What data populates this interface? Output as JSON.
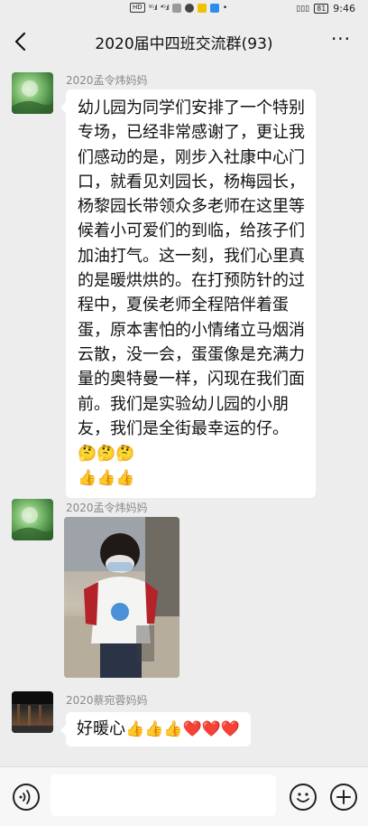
{
  "status_bar": {
    "hd": "HD",
    "signal1": "⁵ᴳ.ıl",
    "signal2": "⁴ᴳ.ıl",
    "vibrate": "▯▯▯",
    "battery": "81",
    "time": "9:46"
  },
  "header": {
    "title": "2020届中四班交流群(93)",
    "more": "···"
  },
  "messages": [
    {
      "sender": "2020孟令炜妈妈",
      "text": "幼儿园为同学们安排了一个特别专场，已经非常感谢了，更让我们感动的是，刚步入社康中心门口，就看见刘园长，杨梅园长，杨黎园长带领众多老师在这里等候着小可爱们的到临，给孩子们加油打气。这一刻，我们心里真的是暖烘烘的。在打预防针的过程中，夏侯老师全程陪伴着蛋蛋，原本害怕的小情绪立马烟消云散，没一会，蛋蛋像是充满力量的奥特曼一样，闪现在我们面前。我们是实验幼儿园的小朋友，我们是全街最幸运的仔。",
      "emoji_tail": "🤔🤔🤔",
      "emoji_line": "👍👍👍"
    },
    {
      "sender": "2020孟令炜妈妈"
    },
    {
      "sender": "2020蔡宛蓉妈妈",
      "text": "好暖心",
      "emoji_tail": "👍👍👍❤️❤️❤️"
    }
  ],
  "input": {
    "placeholder": ""
  },
  "colors": {
    "background": "#ededed",
    "bubble": "#ffffff",
    "sender_text": "#8a8a8a"
  }
}
